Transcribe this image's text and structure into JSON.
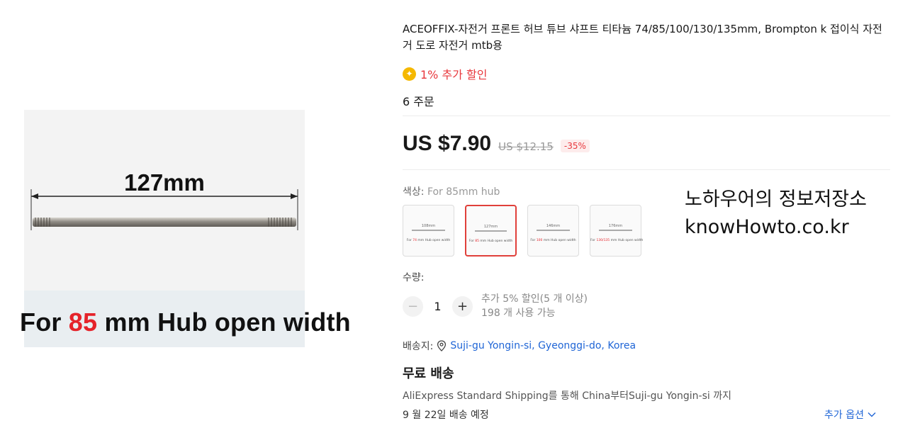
{
  "product": {
    "image_dimension_label": "127mm",
    "image_caption_prefix": "For",
    "image_caption_number": "85",
    "image_caption_suffix": "mm Hub open width",
    "title": "ACEOFFIX-자전거 프론트 허브 튜브 샤프트 티타늄 74/85/100/130/135mm, Brompton k 접이식 자전거 도로 자전거 mtb용",
    "extra_discount": "1% 추가 할인",
    "orders": "6 주문"
  },
  "price": {
    "current": "US $7.90",
    "original": "US $12.15",
    "discount_badge": "-35%"
  },
  "color": {
    "label": "색상:",
    "selected_value": "For 85mm hub",
    "swatches": [
      {
        "dim": "108mm",
        "cap_pre": "For",
        "cap_num": "74",
        "cap_post": "mm Hub open width"
      },
      {
        "dim": "127mm",
        "cap_pre": "For",
        "cap_num": "85",
        "cap_post": "mm Hub open width"
      },
      {
        "dim": "146mm",
        "cap_pre": "For",
        "cap_num": "100",
        "cap_post": "mm Hub open width"
      },
      {
        "dim": "176mm",
        "cap_pre": "For",
        "cap_num": "130/135",
        "cap_post": "mm Hub open width"
      }
    ]
  },
  "watermark": {
    "line1": "노하우어의 정보저장소",
    "line2": "knowHowto.co.kr"
  },
  "quantity": {
    "label": "수량:",
    "value": "1",
    "bulk_discount": "추가 5% 할인(5 개 이상)",
    "available": "198 개 사용 가능"
  },
  "shipping": {
    "label": "배송지:",
    "location": "Suji-gu Yongin-si, Gyeonggi-do, Korea",
    "free_shipping": "무료 배송",
    "description": "AliExpress Standard Shipping를 통해 China부터Suji-gu Yongin-si 까지",
    "delivery_date": "9 월 22일 배송 예정",
    "more_options": "추가 옵션"
  },
  "colors": {
    "accent_red": "#e8383d",
    "link_blue": "#1f65d6",
    "coin_gold": "#f5b800"
  },
  "icons": [
    "coin-icon",
    "location-pin-icon",
    "chevron-down-icon",
    "minus-icon",
    "plus-icon"
  ]
}
